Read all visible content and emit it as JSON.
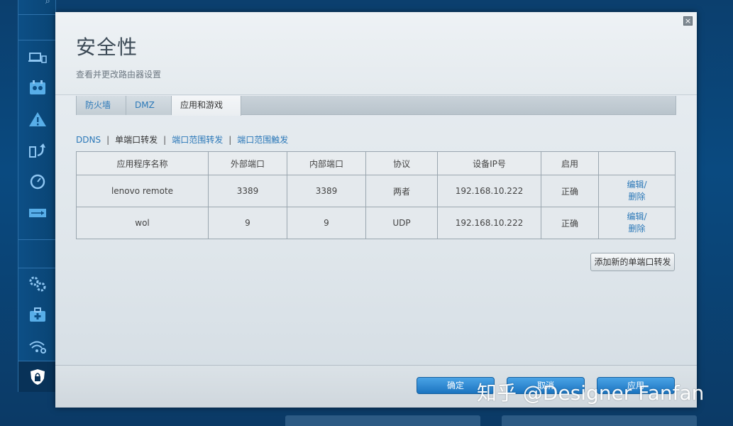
{
  "rail": {
    "items": [
      "device-list-icon",
      "parental-controls-icon",
      "troubleshooting-icon",
      "backup-restore-icon",
      "speed-test-icon",
      "usb-storage-icon",
      "settings-gears-icon",
      "medical-kit-icon",
      "wireless-settings-icon",
      "security-lock-icon"
    ]
  },
  "dialog": {
    "close": "×",
    "title": "安全性",
    "subtitle": "查看并更改路由器设置"
  },
  "tabs": [
    {
      "label": "防火墙"
    },
    {
      "label": "DMZ"
    },
    {
      "label": "应用和游戏"
    }
  ],
  "subnav": {
    "ddns": "DDNS",
    "single_port": "单端口转发",
    "port_range_forward": "端口范围转发",
    "port_range_trigger": "端口范围触发"
  },
  "table": {
    "headers": [
      "应用程序名称",
      "外部端口",
      "内部端口",
      "协议",
      "设备IP号",
      "启用",
      ""
    ],
    "rows": [
      {
        "name": "lenovo remote",
        "ext": "3389",
        "int": "3389",
        "proto": "两者",
        "ip": "192.168.10.222",
        "enabled": "正确",
        "edit": "编辑/",
        "delete": "删除"
      },
      {
        "name": "wol",
        "ext": "9",
        "int": "9",
        "proto": "UDP",
        "ip": "192.168.10.222",
        "enabled": "正确",
        "edit": "编辑/",
        "delete": "删除"
      }
    ]
  },
  "add_button": "添加新的单端口转发",
  "footer": {
    "ok": "确定",
    "cancel": "取消",
    "apply": "应用"
  },
  "watermark": "知乎 @Designer Fanfan"
}
